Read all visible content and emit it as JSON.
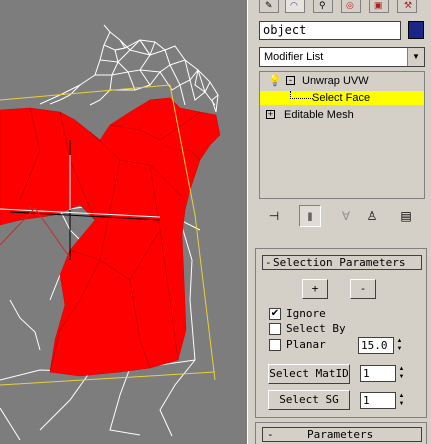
{
  "viewport": {
    "mesh_color": "#ff0000",
    "wire_color": "#ffffff",
    "bbox_color": "#e8d040",
    "background": "#7d7d7d"
  },
  "panel": {
    "object_name": "object",
    "object_color": "#1c2488",
    "modifier_list": "Modifier List",
    "stack": {
      "items": [
        {
          "label": "Unwrap UVW"
        },
        {
          "label": "Select Face"
        },
        {
          "label": "Editable Mesh"
        }
      ]
    },
    "selection": {
      "title": "Selection Parameters",
      "plus": "+",
      "minus": "-",
      "ignore_label": "Ignore",
      "ignore_checked": "✔",
      "select_by_label": "Select By",
      "planar_label": "Planar",
      "planar_value": "15.0",
      "select_matid_label": "Select MatID",
      "matid_value": "1",
      "select_sg_label": "Select SG",
      "sg_value": "1"
    },
    "parameters": {
      "title": "Parameters",
      "collapse": "-"
    }
  }
}
